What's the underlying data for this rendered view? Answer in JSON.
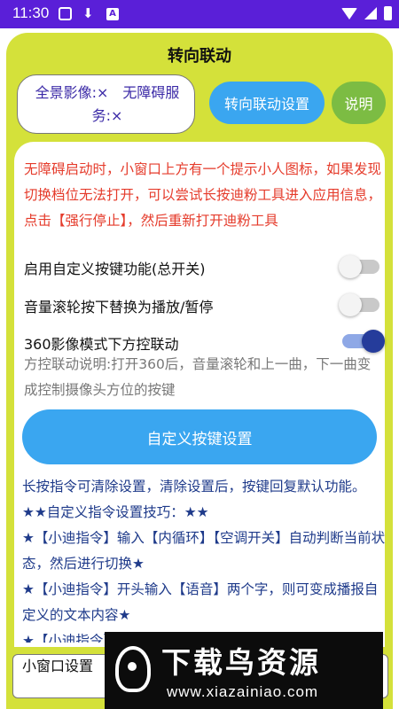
{
  "status_bar": {
    "time": "11:30",
    "badge_letter": "A"
  },
  "header": {
    "title": "转向联动"
  },
  "status_box": {
    "text": "全景影像:×　无障碍服务:×"
  },
  "buttons": {
    "steer_settings": "转向联动设置",
    "help": "说明",
    "custom_keys": "自定义按键设置"
  },
  "warning": "无障碍启动时，小窗口上方有一个提示小人图标，如果发现切换档位无法打开，可以尝试长按迪粉工具进入应用信息，点击【强行停止】，然后重新打开迪粉工具",
  "settings": [
    {
      "label": "启用自定义按键功能(总开关)",
      "enabled": false
    },
    {
      "label": "音量滚轮按下替换为播放/暂停",
      "enabled": false
    },
    {
      "label": "360影像模式下方控联动",
      "enabled": true
    }
  ],
  "description": "方控联动说明:打开360后，音量滚轮和上一曲，下一曲变成控制摄像头方位的按键",
  "instructions": [
    "长按指令可清除设置，清除设置后，按键回复默认功能。",
    "★★自定义指令设置技巧：★★",
    "★【小迪指令】输入【内循环】【空调开关】自动判断当前状态，然后进行切换★",
    "★【小迪指令】开头输入【语音】两个字，则可变成播报自定义的文本内容★",
    "★【小迪指令】"
  ],
  "bottom_field": {
    "value": "小窗口设置"
  },
  "watermark": {
    "title": "下载鸟资源",
    "url": "www.xiazainiao.com"
  },
  "colors": {
    "status_bar": "#5a1fd8",
    "panel": "#d4e13a",
    "primary_button": "#3aa6f0",
    "help_button": "#7cbc43",
    "warning_text": "#e53b2b",
    "instruction_text": "#1e3a8a",
    "toggle_on": "#253c9b"
  }
}
